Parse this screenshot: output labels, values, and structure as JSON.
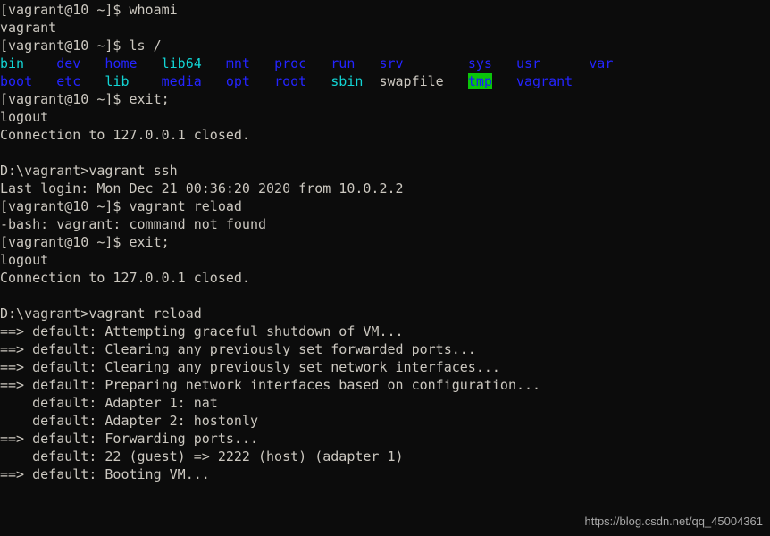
{
  "window": {
    "kind": "windows-command-prompt",
    "background_color": "#0c0c0c",
    "foreground_color": "#ccc8c0"
  },
  "palette": {
    "default": "#ccc8c0",
    "blue": "#2424ff",
    "cyan": "#12d4d4",
    "tmp_foreground": "#1a1aff",
    "tmp_background": "#0ac40a"
  },
  "session": {
    "ssh_prompt": "[vagrant@10 ~]$ ",
    "windows_prompt": "D:\\vagrant>"
  },
  "lines": [
    {
      "id": "l01",
      "text": "[vagrant@10 ~]$ whoami"
    },
    {
      "id": "l02",
      "text": "vagrant"
    },
    {
      "id": "l03",
      "text": "[vagrant@10 ~]$ ls /"
    },
    {
      "id": "l04",
      "text": "bin    dev   home   lib64   mnt   proc   run   srv        sys   usr      var"
    },
    {
      "id": "l05",
      "text": "boot   etc   lib    media   opt   root   sbin  swapfile   tmp   vagrant"
    },
    {
      "id": "l06",
      "text": "[vagrant@10 ~]$ exit;"
    },
    {
      "id": "l07",
      "text": "logout"
    },
    {
      "id": "l08",
      "text": "Connection to 127.0.0.1 closed."
    },
    {
      "id": "l09",
      "text": ""
    },
    {
      "id": "l10",
      "text": "D:\\vagrant>vagrant ssh"
    },
    {
      "id": "l11",
      "text": "Last login: Mon Dec 21 00:36:20 2020 from 10.0.2.2"
    },
    {
      "id": "l12",
      "text": "[vagrant@10 ~]$ vagrant reload"
    },
    {
      "id": "l13",
      "text": "-bash: vagrant: command not found"
    },
    {
      "id": "l14",
      "text": "[vagrant@10 ~]$ exit;"
    },
    {
      "id": "l15",
      "text": "logout"
    },
    {
      "id": "l16",
      "text": "Connection to 127.0.0.1 closed."
    },
    {
      "id": "l17",
      "text": ""
    },
    {
      "id": "l18",
      "text": "D:\\vagrant>vagrant reload"
    },
    {
      "id": "l19",
      "text": "==> default: Attempting graceful shutdown of VM..."
    },
    {
      "id": "l20",
      "text": "==> default: Clearing any previously set forwarded ports..."
    },
    {
      "id": "l21",
      "text": "==> default: Clearing any previously set network interfaces..."
    },
    {
      "id": "l22",
      "text": "==> default: Preparing network interfaces based on configuration..."
    },
    {
      "id": "l23",
      "text": "    default: Adapter 1: nat"
    },
    {
      "id": "l24",
      "text": "    default: Adapter 2: hostonly"
    },
    {
      "id": "l25",
      "text": "==> default: Forwarding ports..."
    },
    {
      "id": "l26",
      "text": "    default: 22 (guest) => 2222 (host) (adapter 1)"
    },
    {
      "id": "l27",
      "text": "==> default: Booting VM..."
    }
  ],
  "ls_output": {
    "command": "ls /",
    "row1": [
      {
        "name": "bin",
        "color": "cyan",
        "pad": 4
      },
      {
        "name": "dev",
        "color": "blue",
        "pad": 3
      },
      {
        "name": "home",
        "color": "blue",
        "pad": 3
      },
      {
        "name": "lib64",
        "color": "cyan",
        "pad": 3
      },
      {
        "name": "mnt",
        "color": "blue",
        "pad": 3
      },
      {
        "name": "proc",
        "color": "blue",
        "pad": 3
      },
      {
        "name": "run",
        "color": "blue",
        "pad": 3
      },
      {
        "name": "srv",
        "color": "blue",
        "pad": 8
      },
      {
        "name": "sys",
        "color": "blue",
        "pad": 3
      },
      {
        "name": "usr",
        "color": "blue",
        "pad": 6
      },
      {
        "name": "var",
        "color": "blue",
        "pad": 0
      }
    ],
    "row2": [
      {
        "name": "boot",
        "color": "blue",
        "pad": 3
      },
      {
        "name": "etc",
        "color": "blue",
        "pad": 3
      },
      {
        "name": "lib",
        "color": "cyan",
        "pad": 4
      },
      {
        "name": "media",
        "color": "blue",
        "pad": 3
      },
      {
        "name": "opt",
        "color": "blue",
        "pad": 3
      },
      {
        "name": "root",
        "color": "blue",
        "pad": 3
      },
      {
        "name": "sbin",
        "color": "cyan",
        "pad": 2
      },
      {
        "name": "swapfile",
        "color": "default",
        "pad": 3
      },
      {
        "name": "tmp",
        "color": "tmp",
        "pad": 3
      },
      {
        "name": "vagrant",
        "color": "blue",
        "pad": 0
      }
    ]
  },
  "watermark": {
    "text": "https://blog.csdn.net/qq_45004361"
  }
}
